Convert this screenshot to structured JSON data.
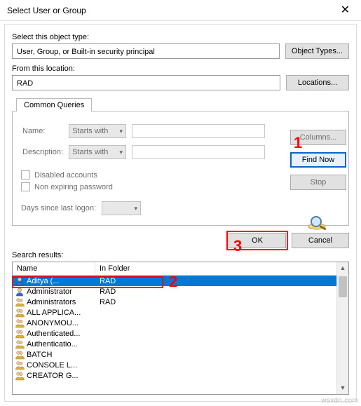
{
  "window": {
    "title": "Select User or Group",
    "close": "✕"
  },
  "labels": {
    "object_type": "Select this object type:",
    "from_location": "From this location:",
    "common_queries_tab": "Common Queries",
    "name": "Name:",
    "description": "Description:",
    "disabled_accounts": "Disabled accounts",
    "non_expiring": "Non expiring password",
    "days_since": "Days since last logon:",
    "search_results": "Search results:",
    "col_name": "Name",
    "col_folder": "In Folder"
  },
  "values": {
    "object_type": "User, Group, or Built-in security principal",
    "from_location": "RAD",
    "name_mode": "Starts with",
    "desc_mode": "Starts with"
  },
  "buttons": {
    "object_types": "Object Types...",
    "locations": "Locations...",
    "columns": "Columns...",
    "find_now": "Find Now",
    "stop": "Stop",
    "ok": "OK",
    "cancel": "Cancel"
  },
  "callouts": {
    "one": "1",
    "two": "2",
    "three": "3"
  },
  "results": [
    {
      "name": "Aditya           (...",
      "folder": "RAD",
      "type": "user",
      "selected": true
    },
    {
      "name": "Administrator",
      "folder": "RAD",
      "type": "user"
    },
    {
      "name": "Administrators",
      "folder": "RAD",
      "type": "group"
    },
    {
      "name": "ALL APPLICA...",
      "folder": "",
      "type": "group"
    },
    {
      "name": "ANONYMOU...",
      "folder": "",
      "type": "group"
    },
    {
      "name": "Authenticated...",
      "folder": "",
      "type": "group"
    },
    {
      "name": "Authenticatio...",
      "folder": "",
      "type": "group"
    },
    {
      "name": "BATCH",
      "folder": "",
      "type": "group"
    },
    {
      "name": "CONSOLE L...",
      "folder": "",
      "type": "group"
    },
    {
      "name": "CREATOR G...",
      "folder": "",
      "type": "group"
    }
  ],
  "watermark": "wsxdn.com"
}
